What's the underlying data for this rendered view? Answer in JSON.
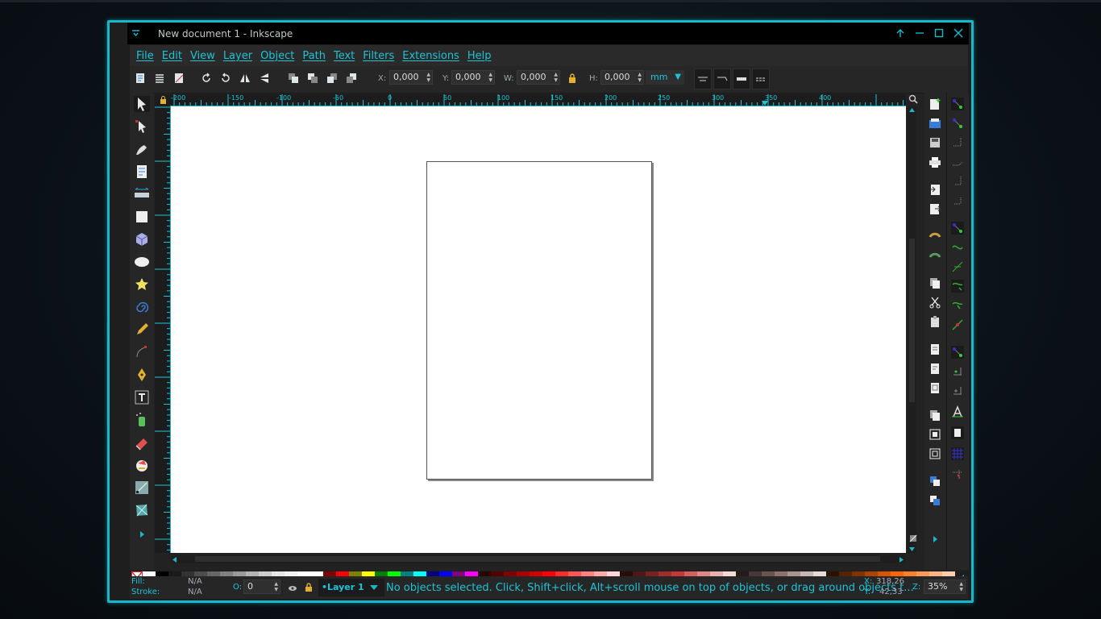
{
  "window": {
    "title": "New document 1 - Inkscape"
  },
  "menu": [
    "File",
    "Edit",
    "View",
    "Layer",
    "Object",
    "Path",
    "Text",
    "Filters",
    "Extensions",
    "Help"
  ],
  "toolbar": {
    "x_label": "X:",
    "x_value": "0,000",
    "y_label": "Y:",
    "y_value": "0,000",
    "w_label": "W:",
    "w_value": "0,000",
    "h_label": "H:",
    "h_value": "0,000",
    "unit": "mm"
  },
  "ruler_h": [
    "-200",
    "-150",
    "-100",
    "-50",
    "0",
    "50",
    "100",
    "150",
    "200",
    "250",
    "300",
    "350",
    "400"
  ],
  "palette": [
    "#ffffff",
    "#000000",
    "#1a1a1a",
    "#333333",
    "#4d4d4d",
    "#666666",
    "#808080",
    "#999999",
    "#b3b3b3",
    "#cccccc",
    "#e6e6e6",
    "#f2f2f2",
    "#ffffff",
    "#ffffff",
    "#800000",
    "#ff0000",
    "#808000",
    "#ffff00",
    "#008000",
    "#00ff00",
    "#008080",
    "#00ffff",
    "#000080",
    "#0000ff",
    "#800080",
    "#ff00ff",
    "#2b0000",
    "#550000",
    "#800000",
    "#aa0000",
    "#d40000",
    "#ff0000",
    "#ff2a2a",
    "#ff5555",
    "#ff8080",
    "#ffaaaa",
    "#ffd5d5",
    "#280b0b",
    "#501616",
    "#782121",
    "#a02c2c",
    "#c83737",
    "#d35f5f",
    "#de8787",
    "#e9afaf",
    "#f4d7d7",
    "#241c1c",
    "#483737",
    "#6c5353",
    "#916f6f",
    "#ac9393",
    "#c8b7b7",
    "#e3dbdb",
    "#2b1100",
    "#552200",
    "#803300",
    "#aa4400",
    "#d45500",
    "#ff6600",
    "#ff7f2a",
    "#ff9955",
    "#ffb380",
    "#ffccaa"
  ],
  "status": {
    "fill_label": "Fill:",
    "fill_value": "N/A",
    "stroke_label": "Stroke:",
    "stroke_value": "N/A",
    "opacity_label": "O:",
    "opacity_value": "0",
    "layer": "•Layer 1",
    "message": "No objects selected. Click, Shift+click, Alt+scroll mouse on top of objects, or drag around objects t...",
    "x_label": "X:",
    "x_value": "318,26",
    "y_label": "Y:",
    "y_value": "42,33",
    "zoom_label": "Z:",
    "zoom_value": "35%"
  }
}
